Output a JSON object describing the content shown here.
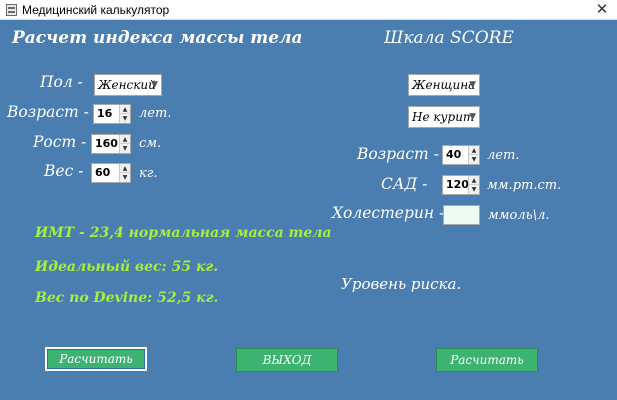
{
  "window": {
    "title": "Медицинский калькулятор",
    "close_glyph": "✕"
  },
  "bmi": {
    "heading": "Расчет индекса массы тела",
    "gender_label": "Пол -",
    "gender_value": "Женский",
    "age_label": "Возраст -",
    "age_value": "16",
    "age_unit": "лет.",
    "height_label": "Рост -",
    "height_value": "160",
    "height_unit": "см.",
    "weight_label": "Вес -",
    "weight_value": "60",
    "weight_unit": "кг.",
    "result_bmi": "ИМТ - 23,4 нормальная масса тела",
    "result_ideal": "Идеальный вес: 55 кг.",
    "result_devine": "Вес по Devine: 52,5 кг.",
    "calc_button": "Расчитать"
  },
  "score": {
    "heading": "Шкала SCORE",
    "gender_value": "Женщина",
    "smoking_value": "Не курит",
    "age_label": "Возраст -",
    "age_value": "40",
    "age_unit": "лет.",
    "sbp_label": "САД -",
    "sbp_value": "120",
    "sbp_unit": "мм.рт.ст.",
    "chol_label": "Холестерин -",
    "chol_value": "",
    "chol_unit": "ммоль\\л.",
    "risk_text": "Уровень риска.",
    "calc_button": "Расчитать"
  },
  "exit_button": "ВЫХОД",
  "colors": {
    "background": "#4a7db0",
    "result_text": "#a7ee3e",
    "button": "#3cb371"
  }
}
